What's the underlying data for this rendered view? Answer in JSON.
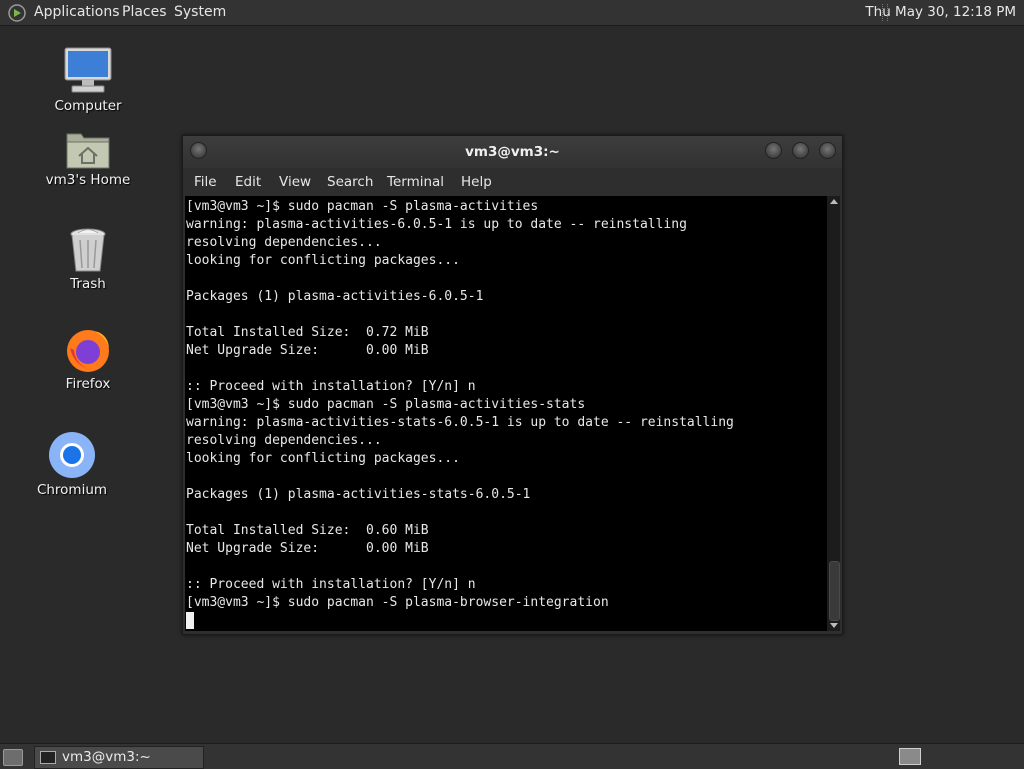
{
  "top_panel": {
    "menus": [
      "Applications",
      "Places",
      "System"
    ],
    "clock": "Thu May 30, 12:18 PM"
  },
  "desktop": {
    "icons": [
      {
        "label": "Computer",
        "icon": "computer-icon"
      },
      {
        "label": "vm3's Home",
        "icon": "home-folder-icon"
      },
      {
        "label": "Trash",
        "icon": "trash-icon"
      },
      {
        "label": "Firefox",
        "icon": "firefox-icon"
      },
      {
        "label": "Chromium",
        "icon": "chromium-icon"
      }
    ]
  },
  "terminal": {
    "title": "vm3@vm3:~",
    "menu": [
      "File",
      "Edit",
      "View",
      "Search",
      "Terminal",
      "Help"
    ],
    "output": "[vm3@vm3 ~]$ sudo pacman -S plasma-activities\nwarning: plasma-activities-6.0.5-1 is up to date -- reinstalling\nresolving dependencies...\nlooking for conflicting packages...\n\nPackages (1) plasma-activities-6.0.5-1\n\nTotal Installed Size:  0.72 MiB\nNet Upgrade Size:      0.00 MiB\n\n:: Proceed with installation? [Y/n] n\n[vm3@vm3 ~]$ sudo pacman -S plasma-activities-stats\nwarning: plasma-activities-stats-6.0.5-1 is up to date -- reinstalling\nresolving dependencies...\nlooking for conflicting packages...\n\nPackages (1) plasma-activities-stats-6.0.5-1\n\nTotal Installed Size:  0.60 MiB\nNet Upgrade Size:      0.00 MiB\n\n:: Proceed with installation? [Y/n] n\n[vm3@vm3 ~]$ sudo pacman -S plasma-browser-integration\n"
  },
  "taskbar": {
    "task_label": "vm3@vm3:~"
  },
  "colors": {
    "panel": "#333333",
    "desktop": "#2a2a2a",
    "terminal_bg": "#000000",
    "terminal_fg": "#e8e8e8"
  }
}
